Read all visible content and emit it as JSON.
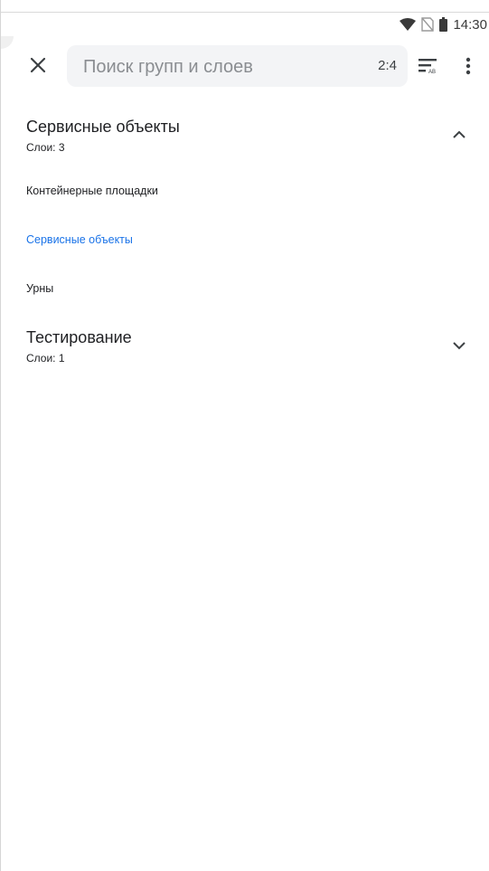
{
  "status_bar": {
    "time": "14:30",
    "icons": [
      "wifi-icon",
      "no-sim-icon",
      "battery-icon"
    ]
  },
  "toolbar": {
    "close_icon": "close-icon",
    "search_placeholder": "Поиск групп и слоев",
    "search_value": "",
    "counter": "2:4",
    "sort_icon": "sort-alpha-icon",
    "more_icon": "more-vert-icon"
  },
  "groups": [
    {
      "title": "Сервисные объекты",
      "subtitle": "Слои: 3",
      "expanded": true,
      "layers": [
        {
          "label": "Контейнерные площадки",
          "active": false
        },
        {
          "label": "Сервисные объекты",
          "active": true
        },
        {
          "label": "Урны",
          "active": false
        }
      ]
    },
    {
      "title": "Тестирование",
      "subtitle": "Слои: 1",
      "expanded": false
    }
  ],
  "colors": {
    "active_text": "#1a73e8",
    "text": "#202124",
    "search_bg": "#f3f4f6"
  }
}
